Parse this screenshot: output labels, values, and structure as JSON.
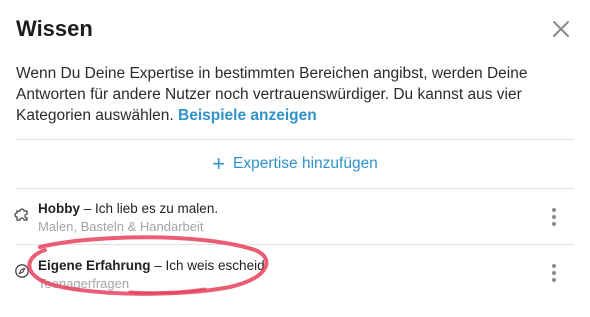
{
  "dialog": {
    "title": "Wissen",
    "description": "Wenn Du Deine Expertise in bestimmten Bereichen angibst, werden Deine Antworten für andere Nutzer noch vertrauenswürdiger. Du kannst aus vier Kategorien auswählen.",
    "examples_link": "Beispiele anzeigen",
    "close_icon": "close-icon"
  },
  "add_expertise": {
    "label": "Expertise hinzufügen",
    "icon": "plus-icon"
  },
  "expertise": [
    {
      "category": "Hobby",
      "separator": " – ",
      "statement": "Ich lieb es zu malen.",
      "topics": "Malen, Basteln & Handarbeit",
      "icon": "puzzle-icon"
    },
    {
      "category": "Eigene Erfahrung",
      "separator": " – ",
      "statement": "Ich weis escheid",
      "topics": "Teenagerfragen",
      "icon": "compass-icon"
    }
  ],
  "colors": {
    "accent": "#2f92c9",
    "annotation": "#e8415c"
  }
}
